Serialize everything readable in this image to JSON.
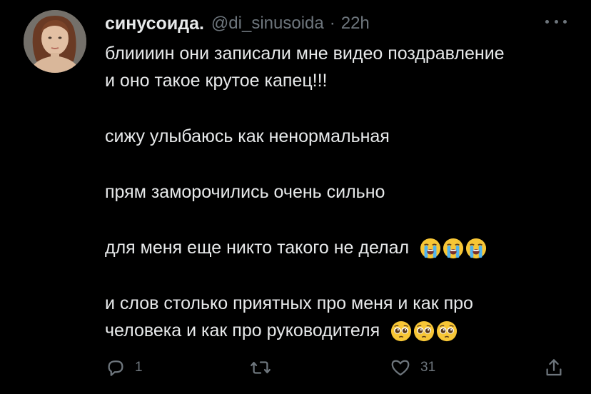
{
  "tweet": {
    "author": {
      "display_name": "синусоида.",
      "handle": "@di_sinusoida",
      "separator": "·",
      "time": "22h"
    },
    "lines": [
      {
        "text": "блиииин они записали мне видео поздравление"
      },
      {
        "text": "и оно такое крутое капец!!!"
      },
      {
        "text": "сижу улыбаюсь как ненормальная"
      },
      {
        "text": "прям заморочились очень сильно"
      },
      {
        "text": "для меня еще никто такого не делал",
        "emoji": "loudly-crying-face",
        "emoji_count": 3
      },
      {
        "text": "и слов столько приятных про меня и как про"
      },
      {
        "text": "человека и как про руководителя",
        "emoji": "pleading-face",
        "emoji_count": 3
      }
    ],
    "actions": {
      "replies": "1",
      "retweets": "",
      "likes": "31"
    }
  },
  "icons": {
    "more": "more-horizontal-icon",
    "reply": "reply-icon",
    "retweet": "retweet-icon",
    "like": "heart-icon",
    "share": "share-icon"
  },
  "colors": {
    "background": "#000000",
    "text": "#e7e9ea",
    "muted": "#6e767d"
  }
}
